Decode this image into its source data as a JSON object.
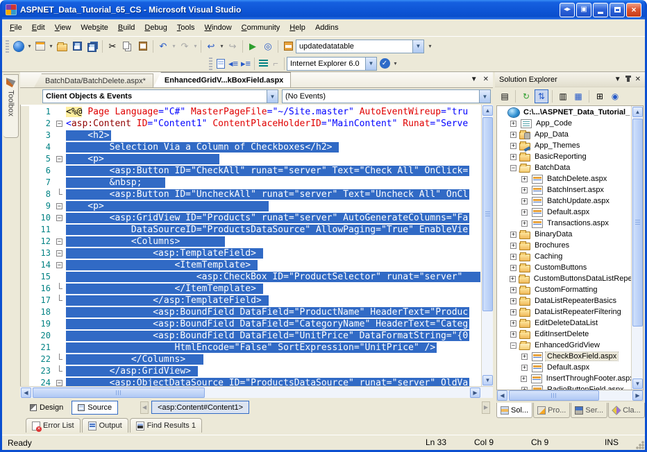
{
  "window": {
    "title": "ASPNET_Data_Tutorial_65_CS - Microsoft Visual Studio"
  },
  "menu": {
    "items": [
      {
        "label": "File",
        "u": 0
      },
      {
        "label": "Edit",
        "u": 0
      },
      {
        "label": "View",
        "u": 0
      },
      {
        "label": "Website",
        "u": 3
      },
      {
        "label": "Build",
        "u": 0
      },
      {
        "label": "Debug",
        "u": 0
      },
      {
        "label": "Tools",
        "u": 0
      },
      {
        "label": "Window",
        "u": 0
      },
      {
        "label": "Community",
        "u": 0
      },
      {
        "label": "Help",
        "u": 0
      },
      {
        "label": "Addins",
        "u": -1
      }
    ]
  },
  "toolbar_main": {
    "find_value": "updatedatatable"
  },
  "toolbar_html": {
    "browser_value": "Internet Explorer 6.0"
  },
  "editor": {
    "tabs": [
      {
        "label": "BatchData/BatchDelete.aspx*",
        "active": false
      },
      {
        "label": "EnhancedGridV...kBoxField.aspx",
        "active": true
      }
    ],
    "object_dropdown": "Client Objects & Events",
    "event_dropdown": "(No Events)",
    "lines": [
      {
        "n": 1,
        "fold": "",
        "sel": false,
        "tokens": [
          {
            "c": "dir",
            "t": "<%@"
          },
          {
            "c": "p",
            "t": " "
          },
          {
            "c": "a",
            "t": "Page"
          },
          {
            "c": "p",
            "t": " "
          },
          {
            "c": "a",
            "t": "Language"
          },
          {
            "c": "v",
            "t": "=\"C#\""
          },
          {
            "c": "p",
            "t": " "
          },
          {
            "c": "a",
            "t": "MasterPageFile"
          },
          {
            "c": "v",
            "t": "=\"~/Site.master\""
          },
          {
            "c": "p",
            "t": " "
          },
          {
            "c": "a",
            "t": "AutoEventWireup"
          },
          {
            "c": "v",
            "t": "=\"tru"
          }
        ]
      },
      {
        "n": 2,
        "fold": "-",
        "sel": false,
        "tokens": [
          {
            "c": "v",
            "t": "<"
          },
          {
            "c": "t",
            "t": "asp:Content"
          },
          {
            "c": "p",
            "t": " "
          },
          {
            "c": "a",
            "t": "ID"
          },
          {
            "c": "v",
            "t": "=\"Content1\""
          },
          {
            "c": "p",
            "t": " "
          },
          {
            "c": "a",
            "t": "ContentPlaceHolderID"
          },
          {
            "c": "v",
            "t": "=\"MainContent\""
          },
          {
            "c": "p",
            "t": " "
          },
          {
            "c": "a",
            "t": "Runat"
          },
          {
            "c": "v",
            "t": "=\"Serve"
          }
        ]
      },
      {
        "n": 3,
        "fold": "",
        "sel": true,
        "text": "    <h2>"
      },
      {
        "n": 4,
        "fold": "",
        "sel": true,
        "text": "        Selection Via a Column of Checkboxes</h2> "
      },
      {
        "n": 5,
        "fold": "-",
        "sel": true,
        "text": "    <p>                     "
      },
      {
        "n": 6,
        "fold": "",
        "sel": true,
        "text": "        <asp:Button ID=\"CheckAll\" runat=\"server\" Text=\"Check All\" OnClick="
      },
      {
        "n": 7,
        "fold": "",
        "sel": true,
        "text": "        &nbsp;    "
      },
      {
        "n": 8,
        "fold": "end",
        "sel": true,
        "text": "        <asp:Button ID=\"UncheckAll\" runat=\"server\" Text=\"Uncheck All\" OnCl"
      },
      {
        "n": 9,
        "fold": "-",
        "sel": true,
        "text": "    <p>                              "
      },
      {
        "n": 10,
        "fold": "-",
        "sel": true,
        "text": "        <asp:GridView ID=\"Products\" runat=\"server\" AutoGenerateColumns=\"Fa"
      },
      {
        "n": 11,
        "fold": "",
        "sel": true,
        "text": "            DataSourceID=\"ProductsDataSource\" AllowPaging=\"True\" EnableVie"
      },
      {
        "n": 12,
        "fold": "-",
        "sel": true,
        "text": "            <Columns>        "
      },
      {
        "n": 13,
        "fold": "-",
        "sel": true,
        "text": "                <asp:TemplateField> "
      },
      {
        "n": 14,
        "fold": "-",
        "sel": true,
        "text": "                    <ItemTemplate> "
      },
      {
        "n": 15,
        "fold": "",
        "sel": true,
        "text": "                        <asp:CheckBox ID=\"ProductSelector\" runat=\"server\"   "
      },
      {
        "n": 16,
        "fold": "end",
        "sel": true,
        "text": "                    </ItemTemplate> "
      },
      {
        "n": 17,
        "fold": "end",
        "sel": true,
        "text": "                </asp:TemplateField> "
      },
      {
        "n": 18,
        "fold": "",
        "sel": true,
        "text": "                <asp:BoundField DataField=\"ProductName\" HeaderText=\"Produc"
      },
      {
        "n": 19,
        "fold": "",
        "sel": true,
        "text": "                <asp:BoundField DataField=\"CategoryName\" HeaderText=\"Categ"
      },
      {
        "n": 20,
        "fold": "",
        "sel": true,
        "text": "                <asp:BoundField DataField=\"UnitPrice\" DataFormatString=\"{0"
      },
      {
        "n": 21,
        "fold": "",
        "sel": true,
        "text": "                    HtmlEncode=\"False\" SortExpression=\"UnitPrice\" />"
      },
      {
        "n": 22,
        "fold": "end",
        "sel": true,
        "text": "            </Columns>   "
      },
      {
        "n": 23,
        "fold": "end",
        "sel": true,
        "text": "        </asp:GridView> "
      },
      {
        "n": 24,
        "fold": "-",
        "sel": true,
        "text": "        <asp:ObjectDataSource ID=\"ProductsDataSource\" runat=\"server\" OldVa"
      }
    ]
  },
  "design_bar": {
    "design_label": "Design",
    "source_label": "Source",
    "tag_navigator": "<asp:Content#Content1>"
  },
  "panel_tabs": [
    {
      "label": "Error List",
      "icon": "err"
    },
    {
      "label": "Output",
      "icon": "out"
    },
    {
      "label": "Find Results 1",
      "icon": "find"
    }
  ],
  "solution_explorer": {
    "title": "Solution Explorer",
    "tree": [
      {
        "label": "C:\\...\\ASPNET_Data_Tutorial_",
        "depth": 0,
        "pm": "",
        "icon": "website-root",
        "root": true
      },
      {
        "label": "App_Code",
        "depth": 1,
        "pm": "+",
        "icon": "app-code"
      },
      {
        "label": "App_Data",
        "depth": 1,
        "pm": "+",
        "icon": "app-data"
      },
      {
        "label": "App_Themes",
        "depth": 1,
        "pm": "+",
        "icon": "app-themes"
      },
      {
        "label": "BasicReporting",
        "depth": 1,
        "pm": "+",
        "icon": "folder"
      },
      {
        "label": "BatchData",
        "depth": 1,
        "pm": "-",
        "icon": "folder-open"
      },
      {
        "label": "BatchDelete.aspx",
        "depth": 2,
        "pm": "+",
        "icon": "aspx-page"
      },
      {
        "label": "BatchInsert.aspx",
        "depth": 2,
        "pm": "+",
        "icon": "aspx-page"
      },
      {
        "label": "BatchUpdate.aspx",
        "depth": 2,
        "pm": "+",
        "icon": "aspx-page"
      },
      {
        "label": "Default.aspx",
        "depth": 2,
        "pm": "+",
        "icon": "aspx-page"
      },
      {
        "label": "Transactions.aspx",
        "depth": 2,
        "pm": "+",
        "icon": "aspx-page"
      },
      {
        "label": "BinaryData",
        "depth": 1,
        "pm": "+",
        "icon": "folder"
      },
      {
        "label": "Brochures",
        "depth": 1,
        "pm": "+",
        "icon": "folder"
      },
      {
        "label": "Caching",
        "depth": 1,
        "pm": "+",
        "icon": "folder"
      },
      {
        "label": "CustomButtons",
        "depth": 1,
        "pm": "+",
        "icon": "folder"
      },
      {
        "label": "CustomButtonsDataListRepeat",
        "depth": 1,
        "pm": "+",
        "icon": "folder"
      },
      {
        "label": "CustomFormatting",
        "depth": 1,
        "pm": "+",
        "icon": "folder"
      },
      {
        "label": "DataListRepeaterBasics",
        "depth": 1,
        "pm": "+",
        "icon": "folder"
      },
      {
        "label": "DataListRepeaterFiltering",
        "depth": 1,
        "pm": "+",
        "icon": "folder"
      },
      {
        "label": "EditDeleteDataList",
        "depth": 1,
        "pm": "+",
        "icon": "folder"
      },
      {
        "label": "EditInsertDelete",
        "depth": 1,
        "pm": "+",
        "icon": "folder"
      },
      {
        "label": "EnhancedGridView",
        "depth": 1,
        "pm": "-",
        "icon": "folder-open"
      },
      {
        "label": "CheckBoxField.aspx",
        "depth": 2,
        "pm": "+",
        "icon": "aspx-page",
        "selected": true
      },
      {
        "label": "Default.aspx",
        "depth": 2,
        "pm": "+",
        "icon": "aspx-page"
      },
      {
        "label": "InsertThroughFooter.aspx",
        "depth": 2,
        "pm": "+",
        "icon": "aspx-page"
      },
      {
        "label": "RadioButtonField.aspx",
        "depth": 2,
        "pm": "+",
        "icon": "aspx-page"
      }
    ],
    "tabs": [
      {
        "label": "Sol...",
        "icon": "sol",
        "active": true
      },
      {
        "label": "Pro...",
        "icon": "pro",
        "active": false
      },
      {
        "label": "Ser...",
        "icon": "ser",
        "active": false
      },
      {
        "label": "Cla...",
        "icon": "cla",
        "active": false
      }
    ]
  },
  "status": {
    "ready": "Ready",
    "line": "Ln 33",
    "column": "Col 9",
    "character": "Ch 9",
    "mode": "INS"
  },
  "colors": {
    "selection": "#316AC5",
    "tag": "#900000",
    "attribute": "#E00000",
    "value": "#0000FF",
    "directive_bg": "#FFEE9E",
    "line_number": "#008284"
  }
}
